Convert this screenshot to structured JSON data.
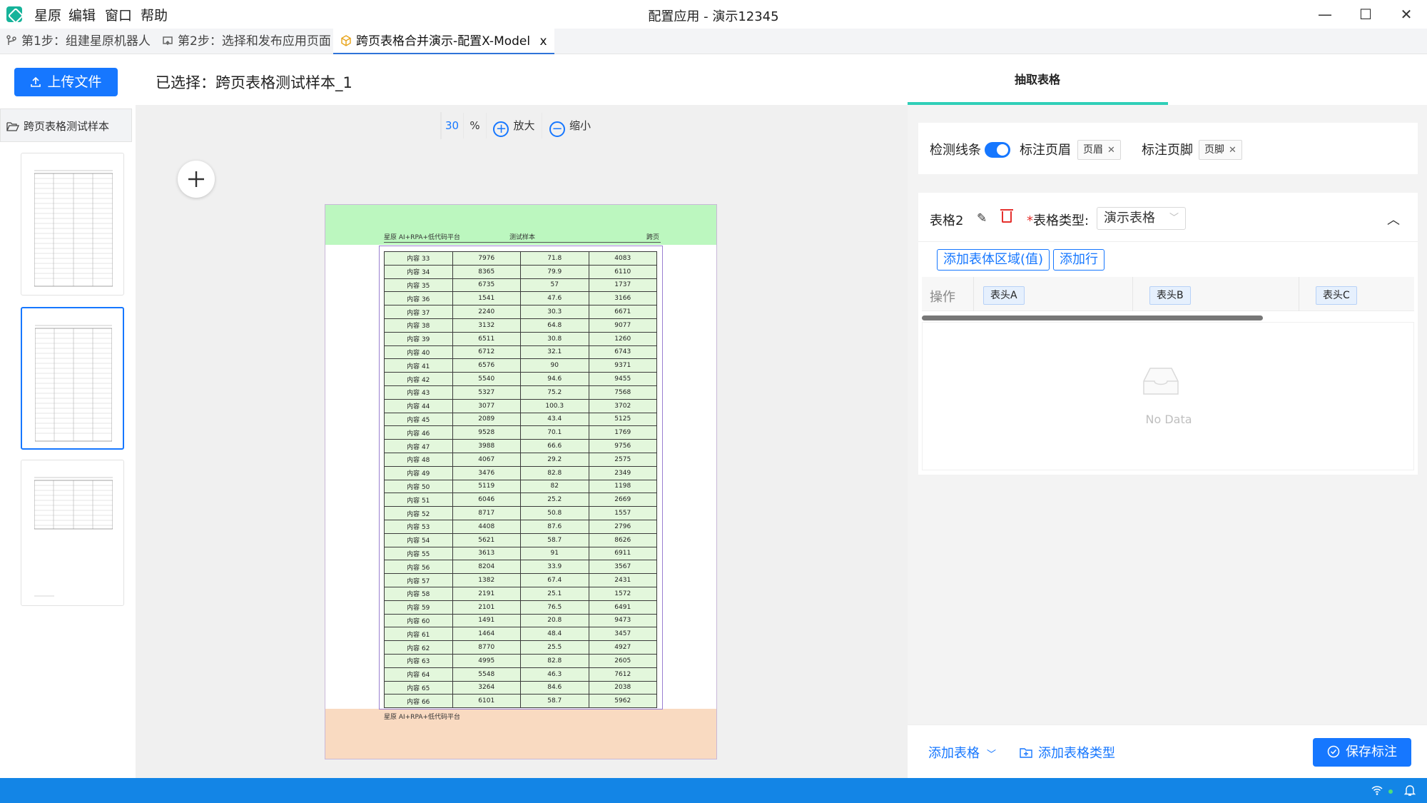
{
  "menu": {
    "items": [
      "星原",
      "编辑",
      "窗口",
      "帮助"
    ]
  },
  "window": {
    "title": "配置应用 - 演示12345",
    "minimize": "—",
    "maximize": "☐",
    "close": "✕"
  },
  "tabs": [
    {
      "label": "第1步：组建星原机器人",
      "icon": "branch-icon"
    },
    {
      "label": "第2步：选择和发布应用页面",
      "icon": "publish-icon"
    },
    {
      "label": "跨页表格合并演示-配置X-Model",
      "icon": "cube-icon",
      "close": "x"
    }
  ],
  "left": {
    "upload_label": "上传文件",
    "selected_text": "已选择：跨页表格测试样本_1",
    "file_item": "跨页表格测试样本"
  },
  "zoom": {
    "value": "30",
    "unit": "%",
    "zoom_in": "放大",
    "zoom_out": "缩小"
  },
  "doc": {
    "header_left": "星原 AI+RPA+低代码平台",
    "header_center": "测试样本",
    "header_right": "跨页",
    "footer": "星原 AI+RPA+低代码平台",
    "rows": [
      [
        "内容 33",
        "7976",
        "71.8",
        "4083"
      ],
      [
        "内容 34",
        "8365",
        "79.9",
        "6110"
      ],
      [
        "内容 35",
        "6735",
        "57",
        "1737"
      ],
      [
        "内容 36",
        "1541",
        "47.6",
        "3166"
      ],
      [
        "内容 37",
        "2240",
        "30.3",
        "6671"
      ],
      [
        "内容 38",
        "3132",
        "64.8",
        "9077"
      ],
      [
        "内容 39",
        "6511",
        "30.8",
        "1260"
      ],
      [
        "内容 40",
        "6712",
        "32.1",
        "6743"
      ],
      [
        "内容 41",
        "6576",
        "90",
        "9371"
      ],
      [
        "内容 42",
        "5540",
        "94.6",
        "9455"
      ],
      [
        "内容 43",
        "5327",
        "75.2",
        "7568"
      ],
      [
        "内容 44",
        "3077",
        "100.3",
        "3702"
      ],
      [
        "内容 45",
        "2089",
        "43.4",
        "5125"
      ],
      [
        "内容 46",
        "9528",
        "70.1",
        "1769"
      ],
      [
        "内容 47",
        "3988",
        "66.6",
        "9756"
      ],
      [
        "内容 48",
        "4067",
        "29.2",
        "2575"
      ],
      [
        "内容 49",
        "3476",
        "82.8",
        "2349"
      ],
      [
        "内容 50",
        "5119",
        "82",
        "1198"
      ],
      [
        "内容 51",
        "6046",
        "25.2",
        "2669"
      ],
      [
        "内容 52",
        "8717",
        "50.8",
        "1557"
      ],
      [
        "内容 53",
        "4408",
        "87.6",
        "2796"
      ],
      [
        "内容 54",
        "5621",
        "58.7",
        "8626"
      ],
      [
        "内容 55",
        "3613",
        "91",
        "6911"
      ],
      [
        "内容 56",
        "8204",
        "33.9",
        "3567"
      ],
      [
        "内容 57",
        "1382",
        "67.4",
        "2431"
      ],
      [
        "内容 58",
        "2191",
        "25.1",
        "1572"
      ],
      [
        "内容 59",
        "2101",
        "76.5",
        "6491"
      ],
      [
        "内容 60",
        "1491",
        "20.8",
        "9473"
      ],
      [
        "内容 61",
        "1464",
        "48.4",
        "3457"
      ],
      [
        "内容 62",
        "8770",
        "25.5",
        "4927"
      ],
      [
        "内容 63",
        "4995",
        "82.8",
        "2605"
      ],
      [
        "内容 64",
        "5548",
        "46.3",
        "7612"
      ],
      [
        "内容 65",
        "3264",
        "84.6",
        "2038"
      ],
      [
        "内容 66",
        "6101",
        "58.7",
        "5962"
      ]
    ]
  },
  "right": {
    "tab_label": "抽取表格",
    "detect_lines_label": "检测线条",
    "detect_lines_on": true,
    "mark_header_label": "标注页眉",
    "header_tag": "页眉",
    "mark_footer_label": "标注页脚",
    "footer_tag": "页脚",
    "table_name": "表格2",
    "required_mark": "*",
    "type_label": "表格类型:",
    "type_value": "演示表格",
    "add_region_label": "添加表体区域(值)",
    "add_row_label": "添加行",
    "ops_label": "操作",
    "columns": [
      "表头A",
      "表头B",
      "表头C"
    ],
    "empty_text": "No Data",
    "add_table_label": "添加表格",
    "add_type_label": "添加表格类型",
    "save_label": "保存标注"
  },
  "colors": {
    "accent": "#1677ff",
    "statusbar": "#1385e6",
    "header_zone": "#bcf7bf",
    "footer_zone": "#f9dac1",
    "table_cell": "#e3f7dc",
    "tab_ink": "#2fcfb8"
  }
}
